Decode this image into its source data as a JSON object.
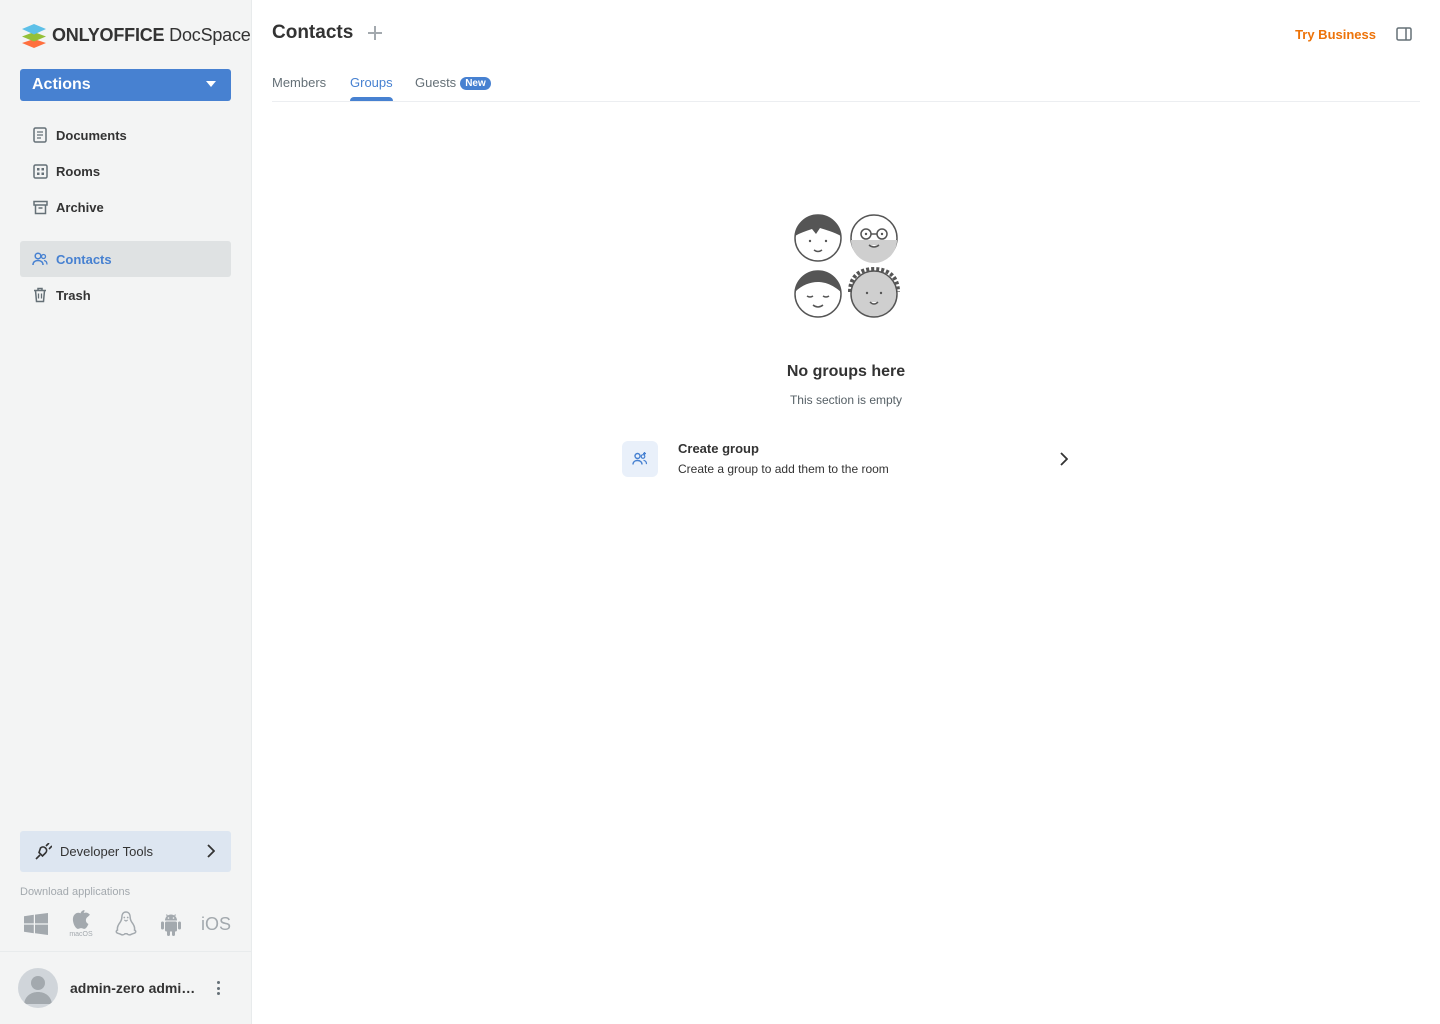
{
  "brand": {
    "name_bold": "ONLYOFFICE",
    "name_light": " DocSpace"
  },
  "sidebar": {
    "actions_label": "Actions",
    "items": [
      {
        "label": "Documents",
        "icon": "document-icon"
      },
      {
        "label": "Rooms",
        "icon": "rooms-icon"
      },
      {
        "label": "Archive",
        "icon": "archive-icon"
      },
      {
        "label": "Contacts",
        "icon": "contacts-icon",
        "active": true
      },
      {
        "label": "Trash",
        "icon": "trash-icon"
      }
    ],
    "developer_tools_label": "Developer Tools",
    "download_title": "Download applications",
    "apps": {
      "windows": "windows-icon",
      "macos_caption": "macOS",
      "linux": "linux-icon",
      "android": "android-icon",
      "ios_label": "iOS"
    },
    "profile_name": "admin-zero admin-..."
  },
  "header": {
    "title": "Contacts",
    "try_business": "Try Business"
  },
  "tabs": [
    {
      "label": "Members"
    },
    {
      "label": "Groups",
      "active": true
    },
    {
      "label": "Guests",
      "badge": "New"
    }
  ],
  "empty": {
    "title": "No groups here",
    "subtitle": "This section is empty",
    "action_title": "Create group",
    "action_subtitle": "Create a group to add them to the room"
  },
  "colors": {
    "accent": "#4781d1",
    "try_business": "#ed7309",
    "sidebar_bg": "#f3f4f4"
  }
}
